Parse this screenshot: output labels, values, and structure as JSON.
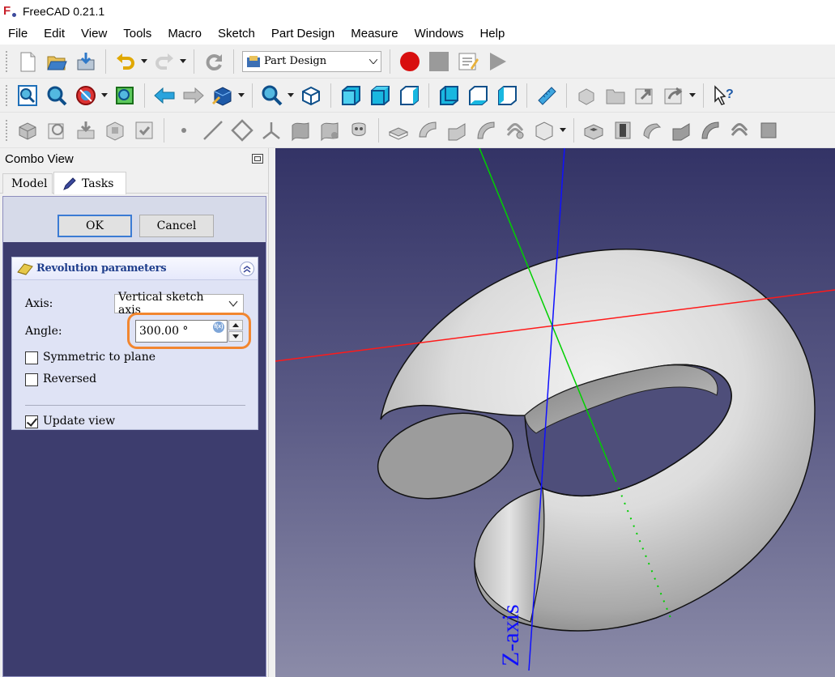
{
  "app": {
    "title": "FreeCAD 0.21.1",
    "brand_color": "#c8202a"
  },
  "menu": [
    "File",
    "Edit",
    "View",
    "Tools",
    "Macro",
    "Sketch",
    "Part Design",
    "Measure",
    "Windows",
    "Help"
  ],
  "toolbar": {
    "workbench": "Part Design"
  },
  "combo_view": {
    "title": "Combo View",
    "tabs": [
      {
        "label": "Model",
        "active": false
      },
      {
        "label": "Tasks",
        "active": true
      }
    ]
  },
  "task_panel": {
    "ok_label": "OK",
    "cancel_label": "Cancel"
  },
  "revolution": {
    "title": "Revolution parameters",
    "axis_label": "Axis:",
    "axis_value": "Vertical sketch axis",
    "angle_label": "Angle:",
    "angle_value": "300.00 °",
    "symmetric_label": "Symmetric to plane",
    "symmetric_checked": false,
    "reversed_label": "Reversed",
    "reversed_checked": false,
    "update_view_label": "Update view",
    "update_view_checked": true,
    "highlight_color": "#f2862f"
  },
  "viewport": {
    "axis_label": "Z-axis",
    "x_axis_color": "#ff0000",
    "y_axis_color": "#00d000",
    "z_axis_color": "#0000ff"
  }
}
